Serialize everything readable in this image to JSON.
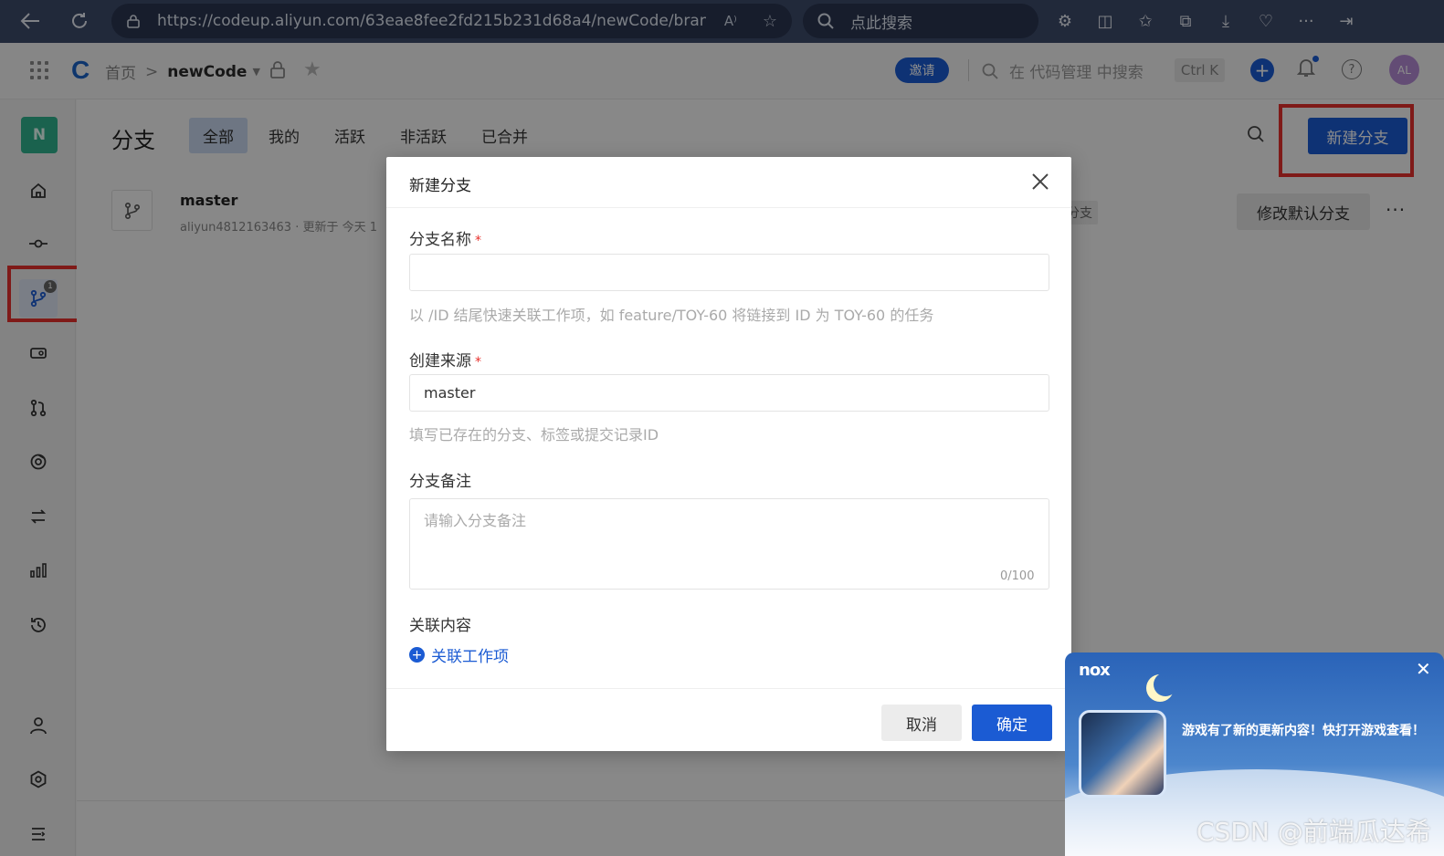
{
  "browser": {
    "url": "https://codeup.aliyun.com/63eae8fee2fd215b231d68a4/newCode/branc...",
    "search_placeholder": "点此搜索",
    "read_aloud": "A⁾"
  },
  "header": {
    "home": "首页",
    "separator": ">",
    "project": "newCode",
    "invite": "邀请",
    "search_placeholder": "在 代码管理 中搜索",
    "shortcut": "Ctrl K",
    "avatar_initials": "AL"
  },
  "rail": {
    "project_initial": "N",
    "branch_badge": "1"
  },
  "page": {
    "title": "分支",
    "tabs": [
      "全部",
      "我的",
      "活跃",
      "非活跃",
      "已合并"
    ],
    "new_branch_button": "新建分支"
  },
  "branch": {
    "name": "master",
    "meta": "aliyun4812163463 · 更新于 今天 1",
    "default_tag": "分支",
    "edit_default_button": "修改默认分支",
    "more": "···"
  },
  "modal": {
    "title": "新建分支",
    "name_label": "分支名称",
    "required_mark": "*",
    "name_value": "",
    "name_hint": "以 /ID 结尾快速关联工作项，如 feature/TOY-60 将链接到 ID 为 TOY-60 的任务",
    "source_label": "创建来源",
    "source_value": "master",
    "source_hint": "填写已存在的分支、标签或提交记录ID",
    "note_label": "分支备注",
    "note_placeholder": "请输入分支备注",
    "note_counter": "0/100",
    "related_label": "关联内容",
    "related_link": "关联工作项",
    "cancel": "取消",
    "confirm": "确定"
  },
  "nox": {
    "logo": "nox",
    "message": "游戏有了新的更新内容！快打开游戏查看！"
  },
  "watermark": "CSDN @前端瓜达希",
  "colors": {
    "primary": "#1b5bd3",
    "highlight": "#e8302c",
    "browser_bar": "#3d4b6b"
  }
}
